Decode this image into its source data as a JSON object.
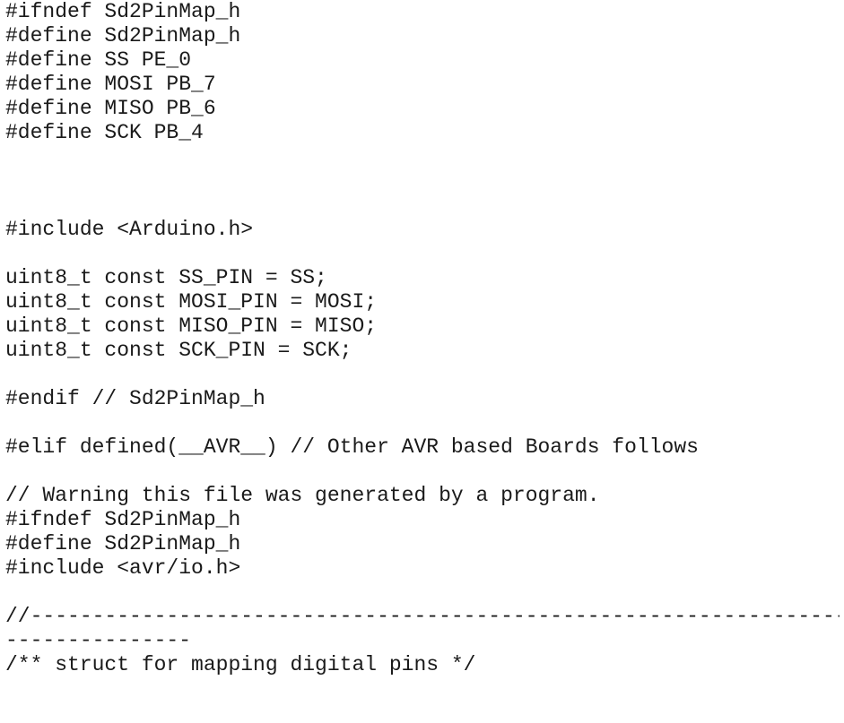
{
  "document": {
    "lines": [
      "#ifndef Sd2PinMap_h",
      "#define Sd2PinMap_h",
      "#define SS PE_0",
      "#define MOSI PB_7",
      "#define MISO PB_6",
      "#define SCK PB_4",
      "",
      "",
      "",
      "#include <Arduino.h>",
      "",
      "uint8_t const SS_PIN = SS;",
      "uint8_t const MOSI_PIN = MOSI;",
      "uint8_t const MISO_PIN = MISO;",
      "uint8_t const SCK_PIN = SCK;",
      "",
      "#endif // Sd2PinMap_h",
      "",
      "#elif defined(__AVR__) // Other AVR based Boards follows",
      "",
      "// Warning this file was generated by a program.",
      "#ifndef Sd2PinMap_h",
      "#define Sd2PinMap_h",
      "#include <avr/io.h>",
      "",
      "//------------------------------------------------------------------",
      "---------------",
      "/** struct for mapping digital pins */"
    ]
  }
}
